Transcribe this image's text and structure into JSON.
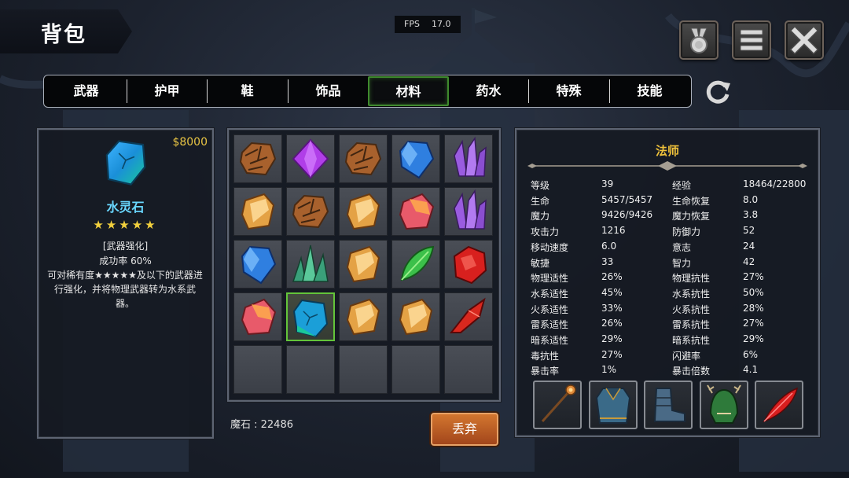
{
  "header": {
    "title": "背包"
  },
  "fps": {
    "label": "FPS",
    "value": "17.0"
  },
  "top_buttons": [
    {
      "name": "achievements",
      "icon": "medal-icon"
    },
    {
      "name": "menu",
      "icon": "menu-icon"
    },
    {
      "name": "close",
      "icon": "close-icon"
    }
  ],
  "tabs": [
    {
      "label": "武器",
      "active": false
    },
    {
      "label": "护甲",
      "active": false
    },
    {
      "label": "鞋",
      "active": false
    },
    {
      "label": "饰品",
      "active": false
    },
    {
      "label": "材料",
      "active": true
    },
    {
      "label": "药水",
      "active": false
    },
    {
      "label": "特殊",
      "active": false
    },
    {
      "label": "技能",
      "active": false
    }
  ],
  "item_detail": {
    "price": "$8000",
    "name": "水灵石",
    "stars": "★★★★★",
    "category": "[武器强化]",
    "success_rate": "成功率  60%",
    "description": "可对稀有度★★★★★及以下的武器进行强化，并将物理武器转为水系武器。",
    "icon": "teal-stone"
  },
  "inventory": [
    [
      "brown-rock",
      "purple-gem",
      "brown-rock",
      "blue-crystal",
      "purple-crystals"
    ],
    [
      "amber-shard",
      "brown-rock",
      "amber-shard",
      "pink-shard",
      "purple-crystals"
    ],
    [
      "blue-crystal",
      "green-crystals",
      "amber-shard",
      "green-leaf-crystal",
      "red-gem"
    ],
    [
      "pink-shard",
      "teal-stone",
      "amber-shard",
      "amber-shard",
      "red-shard"
    ],
    [
      "",
      "",
      "",
      "",
      ""
    ]
  ],
  "selected_slot": [
    3,
    1
  ],
  "currency": {
    "label": "魔石 : 22486"
  },
  "discard_label": "丢弃",
  "character": {
    "class": "法师",
    "stats_left": [
      [
        "等级",
        "39"
      ],
      [
        "生命",
        "5457/5457"
      ],
      [
        "魔力",
        "9426/9426"
      ],
      [
        "攻击力",
        "1216"
      ],
      [
        "移动速度",
        "6.0"
      ],
      [
        "敏捷",
        "33"
      ],
      [
        "物理适性",
        "26%"
      ],
      [
        "水系适性",
        "45%"
      ],
      [
        "火系适性",
        "33%"
      ],
      [
        "雷系适性",
        "26%"
      ],
      [
        "暗系适性",
        "29%"
      ],
      [
        "毒抗性",
        "27%"
      ],
      [
        "暴击率",
        "1%"
      ]
    ],
    "stats_right": [
      [
        "经验",
        "18464/22800"
      ],
      [
        "生命恢复",
        "8.0"
      ],
      [
        "魔力恢复",
        "3.8"
      ],
      [
        "防御力",
        "52"
      ],
      [
        "意志",
        "24"
      ],
      [
        "智力",
        "42"
      ],
      [
        "物理抗性",
        "27%"
      ],
      [
        "水系抗性",
        "50%"
      ],
      [
        "火系抗性",
        "28%"
      ],
      [
        "雷系抗性",
        "27%"
      ],
      [
        "暗系抗性",
        "29%"
      ],
      [
        "闪避率",
        "6%"
      ],
      [
        "暴击倍数",
        "4.1"
      ]
    ],
    "equipment": [
      "staff",
      "robe",
      "boots",
      "helmet",
      "red-feather"
    ]
  },
  "colors": {
    "accent_gold": "#f0c23b",
    "active_tab": "#3f8a2e",
    "item_name": "#69d7ff",
    "discard": "#c4622a"
  }
}
